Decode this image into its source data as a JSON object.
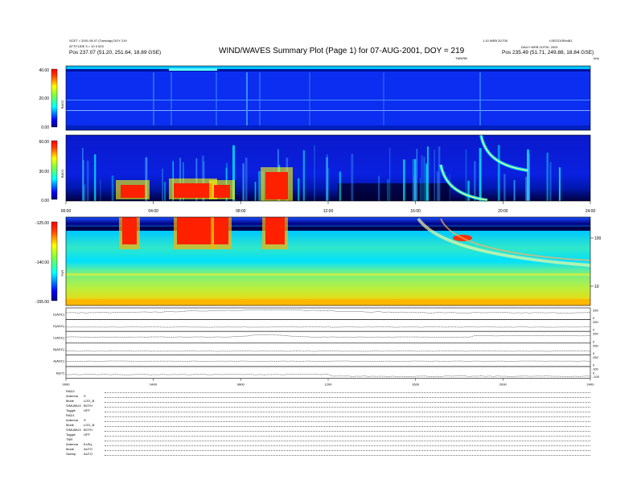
{
  "header": {
    "title": "WIND/WAVES Summary Plot (Page 1) for 07-AUG-2001, DOY = 219",
    "left_line1": "SCET = 2001 08 07 (Tuesday)  DOY 219",
    "left_line2": "ATTITUDE 3 = 10 0 003",
    "left_line3": "Pos   237.07 (51.20, 251.64, 18.89 GSE)",
    "right_line1": "1.10 WEB 2UT00",
    "right_line1b": "LSEGOORx481",
    "right_line2": "DAILY WEB 2UT00, 2002",
    "right_line3": "Pos   235.49 (51.71, 249.88, 18.84 GSE)",
    "tnr_label_right": "TNR/RB",
    "khz_label": "kHz",
    "rad2_time_label": "RAD2"
  },
  "chart_data": [
    {
      "type": "heatmap",
      "name": "RAD2",
      "colorbar_ticks": [
        "40.00",
        "20.00",
        "0.00"
      ],
      "colorbar_range": [
        0,
        40
      ]
    },
    {
      "type": "heatmap",
      "name": "RAD1",
      "colorbar_ticks": [
        "60.00",
        "30.00",
        "0.00"
      ],
      "colorbar_range": [
        0,
        60
      ],
      "time_ticks": [
        "00:00",
        "04:00",
        "08:00",
        "12:00",
        "16:00",
        "20:00",
        "24:00"
      ]
    },
    {
      "type": "heatmap",
      "name": "TNR",
      "colorbar_ticks": [
        "-125.00",
        "-140.00",
        "-155.00"
      ],
      "colorbar_range": [
        -155,
        -125
      ],
      "freq_ticks": [
        "100",
        "10"
      ]
    },
    {
      "type": "line",
      "name": "housekeeping",
      "rows": [
        {
          "label": "E(ADC)",
          "axis_ticks": [
            "250",
            "0"
          ],
          "base": 0.55
        },
        {
          "label": "E(ADC)",
          "axis_ticks": [
            "250",
            "0"
          ],
          "base": 0.35
        },
        {
          "label": "C(ADC)",
          "axis_ticks": [
            "250",
            "0"
          ],
          "base": 0.5
        },
        {
          "label": "B(ADC)",
          "axis_ticks": [
            "250",
            "0"
          ],
          "base": 0.3
        },
        {
          "label": "A(ADC)",
          "axis_ticks": [
            "250",
            "0"
          ],
          "base": 0.45
        },
        {
          "label": "B(nT)",
          "axis_ticks": [
            "100",
            "0",
            "-100"
          ],
          "base": 0.3
        }
      ],
      "time_ticks": [
        "0000",
        "0400",
        "0800",
        "1200",
        "1600",
        "2000",
        "2400"
      ]
    }
  ],
  "status": [
    {
      "label": "RAD2",
      "value": ""
    },
    {
      "label": "Antenna",
      "value": "S"
    },
    {
      "label": "Mode",
      "value": "LOG_B"
    },
    {
      "label": "S/MUMUX",
      "value": "BOTH"
    },
    {
      "label": "Toggle",
      "value": "OFF"
    },
    {
      "label": "RAD1",
      "value": ""
    },
    {
      "label": "Antenna",
      "value": "S"
    },
    {
      "label": "Mode",
      "value": "LOG_B"
    },
    {
      "label": "S/MUMUX",
      "value": "BOTH"
    },
    {
      "label": "Toggle",
      "value": "OFF"
    },
    {
      "label": "TNR",
      "value": ""
    },
    {
      "label": "Antenna",
      "value": "Ex/Ey"
    },
    {
      "label": "Mode",
      "value": "AUTO"
    },
    {
      "label": "Sweep",
      "value": "AUTO"
    }
  ]
}
